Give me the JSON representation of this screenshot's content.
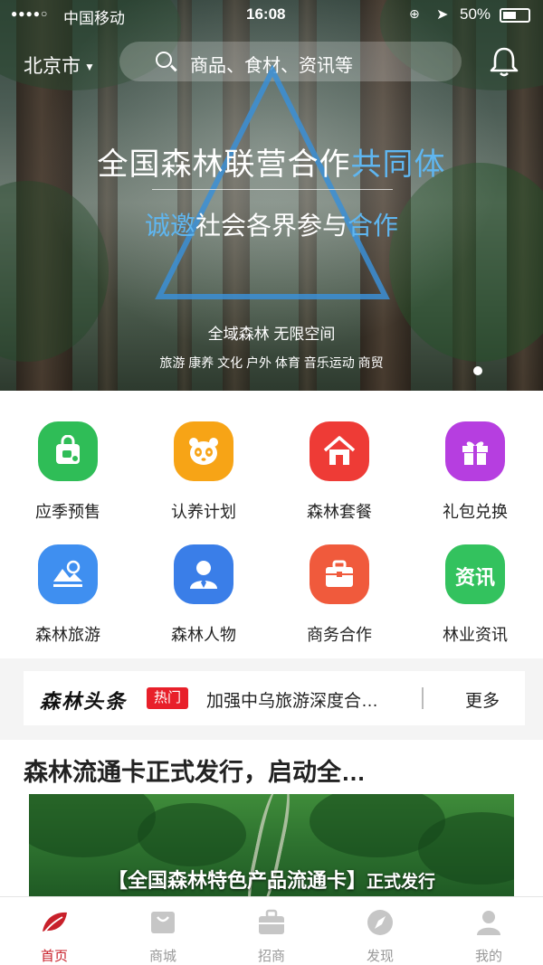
{
  "status_bar": {
    "signal": "●●●●○",
    "carrier": "中国移动",
    "time": "16:08",
    "battery": "50%"
  },
  "header": {
    "city": "北京市",
    "search_placeholder": "商品、食材、资讯等"
  },
  "banner": {
    "headline_white": "全国森林联营合作",
    "headline_blue": "共同体",
    "subline_blue_1": "诚邀",
    "subline_white": "社会各界参与",
    "subline_blue_2": "合作",
    "caption_1": "全域森林  无限空间",
    "caption_2": "旅游  康养  文化  户外  体育  音乐运动  商贸"
  },
  "categories": [
    {
      "label": "应季预售",
      "icon": "shopping-bag-icon",
      "color": "#2fbd57"
    },
    {
      "label": "认养计划",
      "icon": "panda-icon",
      "color": "#f7a416"
    },
    {
      "label": "森林套餐",
      "icon": "house-icon",
      "color": "#ee3b36"
    },
    {
      "label": "礼包兑换",
      "icon": "gift-icon",
      "color": "#b63ee0"
    },
    {
      "label": "森林旅游",
      "icon": "mountain-icon",
      "color": "#3f8ff0"
    },
    {
      "label": "森林人物",
      "icon": "person-icon",
      "color": "#3a7ee8"
    },
    {
      "label": "商务合作",
      "icon": "briefcase-icon",
      "color": "#f05a3c"
    },
    {
      "label": "林业资讯",
      "icon": "news-icon",
      "color": "#33c25e",
      "icon_text": "资讯"
    }
  ],
  "news_strip": {
    "logo": "森林头条",
    "badge": "热门",
    "title": "加强中乌旅游深度合…",
    "more": "更多"
  },
  "article": {
    "title": "森林流通卡正式发行，启动全…",
    "image_text_main": "【全国森林特色产品流通卡】",
    "image_text_small": "正式发行"
  },
  "tabbar": [
    {
      "label": "首页",
      "icon": "leaf-icon",
      "active": true
    },
    {
      "label": "商城",
      "icon": "bag-icon",
      "active": false
    },
    {
      "label": "招商",
      "icon": "briefcase-icon",
      "active": false
    },
    {
      "label": "发现",
      "icon": "compass-icon",
      "active": false
    },
    {
      "label": "我的",
      "icon": "user-icon",
      "active": false
    }
  ]
}
